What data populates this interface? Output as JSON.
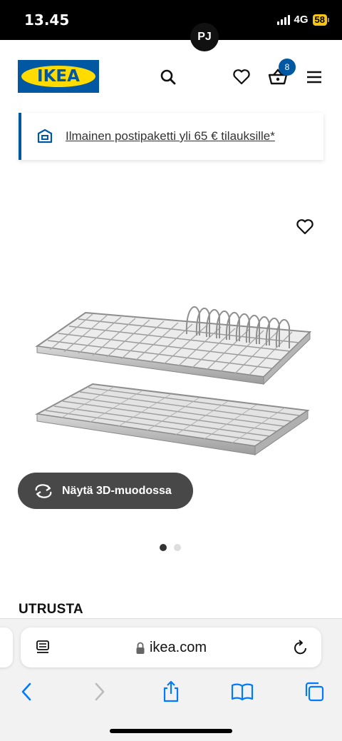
{
  "status_bar": {
    "time": "13.45",
    "network": "4G",
    "battery": "58"
  },
  "header": {
    "logo_text": "IKEA",
    "avatar_initials": "PJ",
    "cart_count": "8",
    "icons": [
      "search-icon",
      "heart-icon",
      "basket-icon",
      "menu-icon"
    ]
  },
  "promo": {
    "text": "Ilmainen postipaketti yli 65 € tilauksille*",
    "icon": "delivery-box-icon"
  },
  "product": {
    "view_3d_label": "Näytä 3D-muodossa",
    "carousel": {
      "count": 2,
      "active_index": 0
    }
  },
  "section": {
    "title": "UTRUSTA"
  },
  "browser": {
    "url": "ikea.com",
    "toolbar_icons": [
      "back-icon",
      "forward-icon",
      "share-icon",
      "bookmarks-icon",
      "tabs-icon"
    ]
  },
  "colors": {
    "brand_blue": "#0058a3",
    "brand_yellow": "#ffdb00",
    "ios_blue": "#007aff"
  }
}
